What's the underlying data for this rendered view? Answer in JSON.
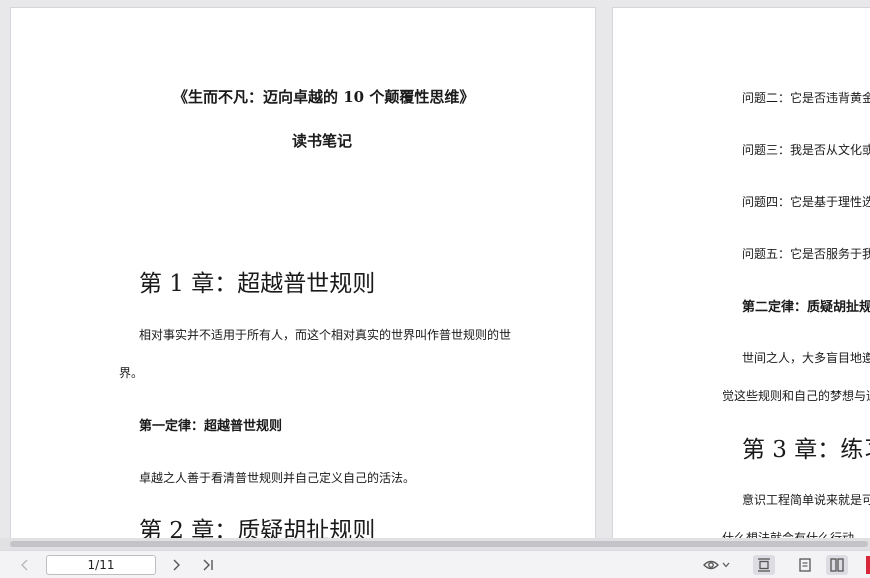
{
  "left_page": {
    "book_title": "《生而不凡：迈向卓越的 10 个颠覆性思维》",
    "notes_title": "读书笔记",
    "chapter1": "第 1 章：超越普世规则",
    "para1_line1": "相对事实并不适用于所有人，而这个相对真实的世界叫作普世规则的世",
    "para1_line2": "界。",
    "law1": "第一定律：超越普世规则",
    "para2": "卓越之人善于看清普世规则并自己定义自己的活法。",
    "chapter2": "第 2 章：质疑胡扯规则"
  },
  "right_page": {
    "q2": "问题二：它是否违背黄金",
    "q3": "问题三：我是否从文化或",
    "q4": "问题四：它是基于理性选",
    "q5": "问题五：它是否服务于我",
    "law2": "第二定律：质疑胡扯规",
    "para_a_line1": "世间之人，大多盲目地遵",
    "para_a_line2": "觉这些规则和自己的梦想与追",
    "chapter3": "第 3 章：练习",
    "para_b_line1": "意识工程简单说来就是可",
    "para_b_line2": "什么想法就会有什么行动。"
  },
  "toolbar": {
    "page_indicator": "1/11",
    "icons": [
      "chevron-left-icon",
      "chevron-right-icon",
      "skip-to-last-icon",
      "eye-icon",
      "fit-page-icon",
      "single-page-icon",
      "two-page-icon"
    ]
  },
  "colors": {
    "accent": "#d8263b",
    "background": "#e8e8eb",
    "page": "#ffffff"
  }
}
